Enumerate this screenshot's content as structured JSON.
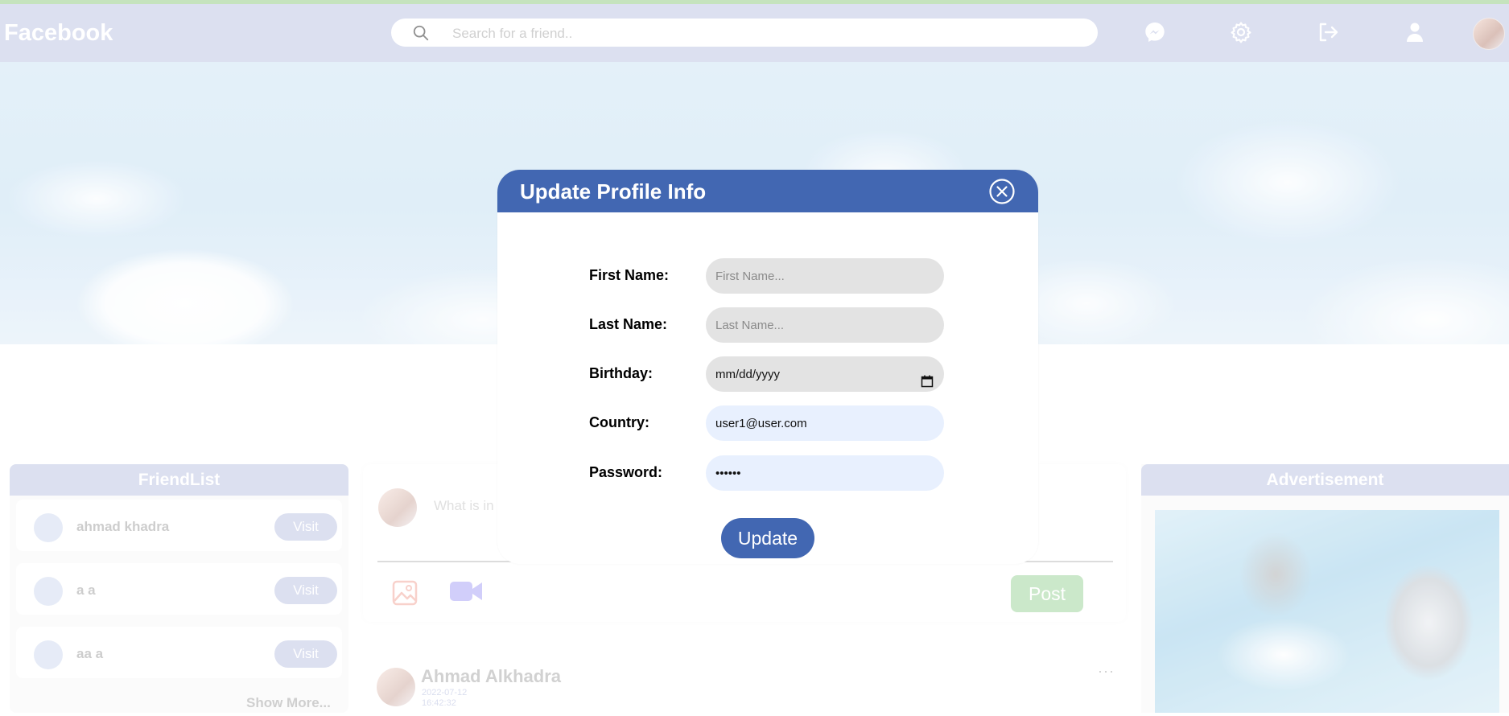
{
  "app": {
    "brand": "Facebook"
  },
  "navbar": {
    "search_placeholder": "Search for a friend..",
    "icons": [
      "messenger-icon",
      "gear-icon",
      "logout-icon",
      "person-icon"
    ]
  },
  "friendlist": {
    "title": "FriendList",
    "friends": [
      {
        "name": "ahmad khadra",
        "button": "Visit"
      },
      {
        "name": "a a",
        "button": "Visit"
      },
      {
        "name": "aa a",
        "button": "Visit"
      }
    ],
    "show_more": "Show More..."
  },
  "composer": {
    "prompt": "What is in",
    "post_button": "Post"
  },
  "post": {
    "author": "Ahmad Alkhadra",
    "date": "2022-07-12",
    "time": "16:42:32",
    "menu": "···"
  },
  "advertisement": {
    "title": "Advertisement"
  },
  "modal": {
    "title": "Update Profile Info",
    "fields": {
      "first_name": {
        "label": "First Name:",
        "placeholder": "First Name...",
        "value": ""
      },
      "last_name": {
        "label": "Last Name:",
        "placeholder": "Last Name...",
        "value": ""
      },
      "birthday": {
        "label": "Birthday:",
        "placeholder": "mm/dd/yyyy",
        "value": "mm/dd/yyyy"
      },
      "country": {
        "label": "Country:",
        "placeholder": "",
        "value": "user1@user.com"
      },
      "password": {
        "label": "Password:",
        "placeholder": "",
        "value": "••••••"
      }
    },
    "update_button": "Update"
  },
  "colors": {
    "navbar": "#c9cfe9",
    "modal_header": "#4267b2",
    "post_button": "#b0dcae",
    "top_strip": "#a6d49a"
  }
}
